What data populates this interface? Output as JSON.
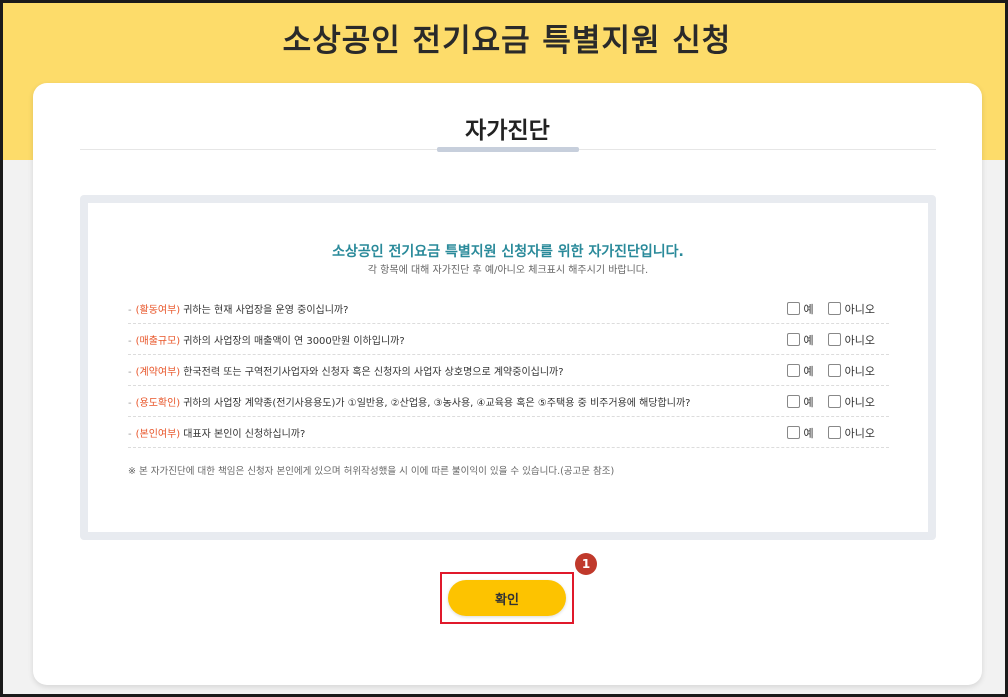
{
  "header": {
    "title": "소상공인 전기요금 특별지원 신청"
  },
  "section": {
    "title": "자가진단"
  },
  "diagnosis": {
    "headline": "소상공인 전기요금 특별지원 신청자를 위한 자가진단입니다.",
    "subline": "각 항목에 대해 자가진단 후 예/아니오 체크표시 해주시기 바랍니다.",
    "yes_label": "예",
    "no_label": "아니오",
    "questions": [
      {
        "dash": "-",
        "tag": "(활동여부)",
        "text": "귀하는 현재 사업장을 운영 중이십니까?"
      },
      {
        "dash": "-",
        "tag": "(매출규모)",
        "text": "귀하의 사업장의 매출액이 연 3000만원 이하입니까?"
      },
      {
        "dash": "-",
        "tag": "(계약여부)",
        "text": "한국전력 또는 구역전기사업자와 신청자 혹은 신청자의 사업자 상호명으로 계약중이십니까?"
      },
      {
        "dash": "-",
        "tag": "(용도확인)",
        "text": "귀하의 사업장 계약종(전기사용용도)가 ①일반용, ②산업용, ③농사용, ④교육용 혹은 ⑤주택용 중 비주거용에 해당합니까?"
      },
      {
        "dash": "-",
        "tag": "(본인여부)",
        "text": "대표자 본인이 신청하십니까?"
      }
    ],
    "notice": "※ 본 자가진단에 대한 책임은 신청자 본인에게 있으며 허위작성했을 시 이에 따른 불이익이 있을 수 있습니다.(공고문 참조)"
  },
  "actions": {
    "confirm_label": "확인",
    "step_number": "1"
  },
  "colors": {
    "band": "#fddc6a",
    "accent_text": "#2a8a9a",
    "tag": "#e8562a",
    "button": "#fdc300",
    "highlight": "#e0192b"
  }
}
